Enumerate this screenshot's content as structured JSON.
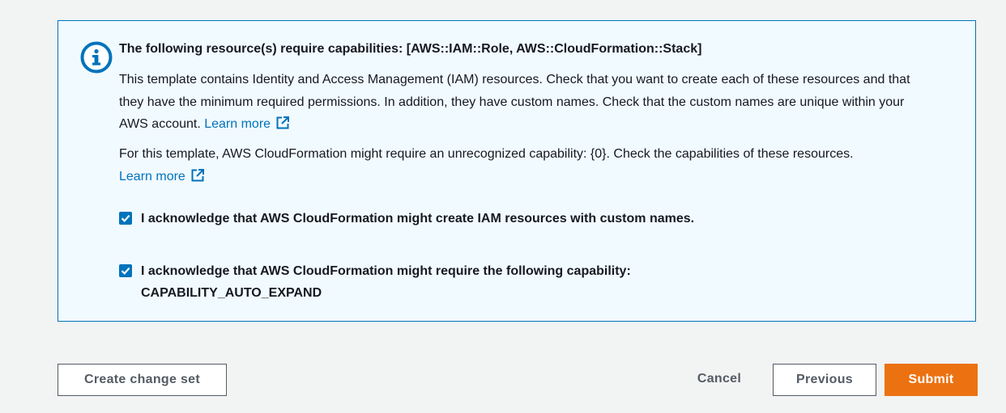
{
  "alert": {
    "title": "The following resource(s) require capabilities: [AWS::IAM::Role, AWS::CloudFormation::Stack]",
    "paragraph1": "This template contains Identity and Access Management (IAM) resources. Check that you want to create each of these resources and that they have the minimum required permissions. In addition, they have custom names. Check that the custom names are unique within your AWS account.",
    "paragraph2": "For this template, AWS CloudFormation might require an unrecognized capability: {0}. Check the capabilities of these resources.",
    "learn_more": "Learn more",
    "icon": "info-icon",
    "accent_color": "#0073bb",
    "background_color": "#f1faff"
  },
  "acknowledgements": [
    {
      "checked": true,
      "label": "I acknowledge that AWS CloudFormation might create IAM resources with custom names."
    },
    {
      "checked": true,
      "label": "I acknowledge that AWS CloudFormation might require the following capability: CAPABILITY_AUTO_EXPAND"
    }
  ],
  "footer": {
    "create_change_set": "Create change set",
    "cancel": "Cancel",
    "previous": "Previous",
    "submit": "Submit",
    "submit_color": "#ec7211"
  }
}
